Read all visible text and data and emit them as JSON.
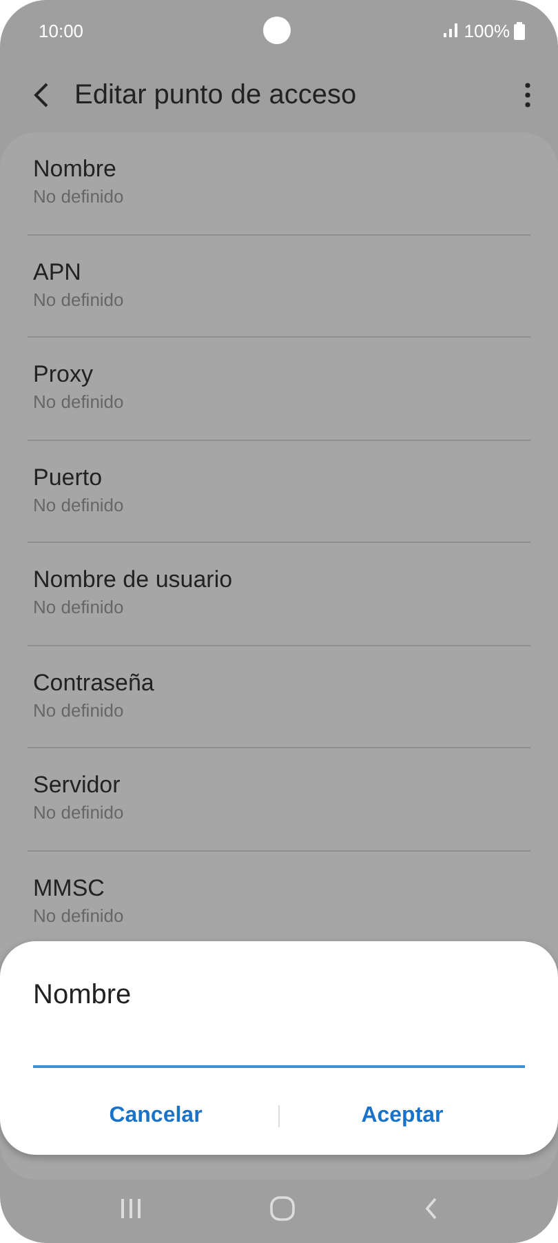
{
  "status_bar": {
    "time": "10:00",
    "battery": "100%"
  },
  "header": {
    "title": "Editar punto de acceso"
  },
  "settings": [
    {
      "title": "Nombre",
      "value": "No definido"
    },
    {
      "title": "APN",
      "value": "No definido"
    },
    {
      "title": "Proxy",
      "value": "No definido"
    },
    {
      "title": "Puerto",
      "value": "No definido"
    },
    {
      "title": "Nombre de usuario",
      "value": "No definido"
    },
    {
      "title": "Contraseña",
      "value": "No definido"
    },
    {
      "title": "Servidor",
      "value": "No definido"
    },
    {
      "title": "MMSC",
      "value": "No definido"
    }
  ],
  "dialog": {
    "title": "Nombre",
    "buttons": [
      "Cancelar",
      "Aceptar"
    ]
  }
}
